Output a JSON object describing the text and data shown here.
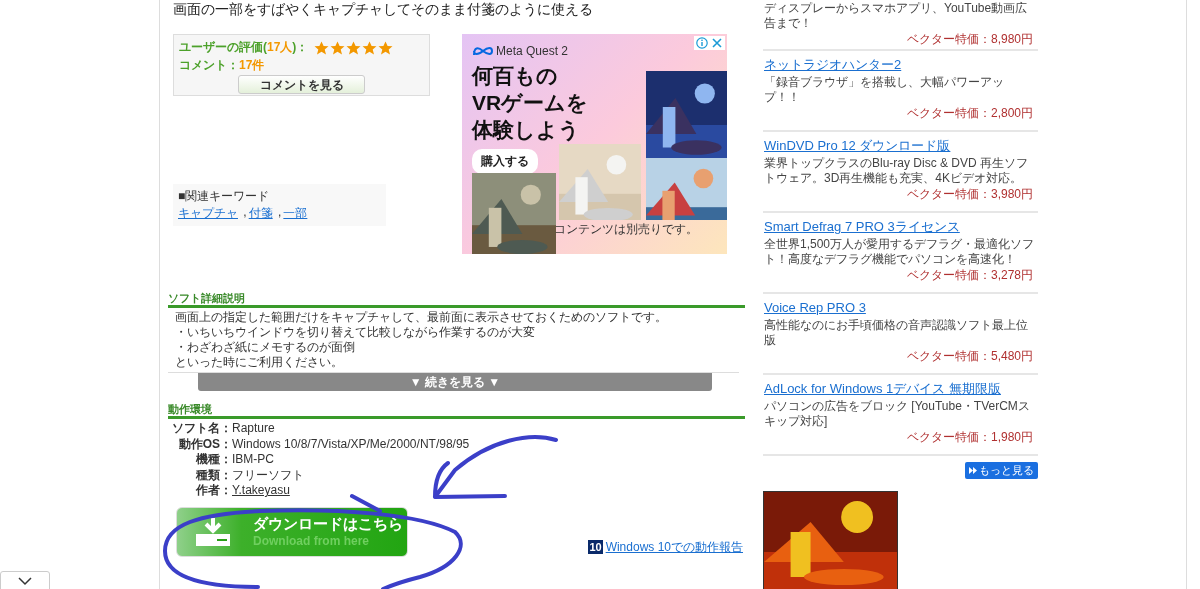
{
  "page_heading": "画面の一部をすばやくキャプチャしてそのまま付箋のように使える",
  "rating": {
    "prefix": "ユーザーの評価(",
    "count": "17人",
    "suffix": ")：",
    "stars": 5,
    "comment_label": "コメント：",
    "comment_count": "17件",
    "button": "コメントを見る"
  },
  "keywords": {
    "title": "■関連キーワード",
    "separator": " ,",
    "links": [
      "キャプチャ",
      "付箋",
      "一部"
    ]
  },
  "ad": {
    "brand": "Meta Quest 2",
    "headline": [
      "何百もの",
      "VRゲームを",
      "体験しよう"
    ],
    "cta": "購入する",
    "note": "コンテンツは別売りです。"
  },
  "description": {
    "title": "ソフト詳細説明",
    "lines": [
      "画面上の指定した範囲だけをキャプチャして、最前面に表示させておくためのソフトです。",
      "・いちいちウインドウを切り替えて比較しながら作業するのが大変",
      "・わざわざ紙にメモするのが面倒",
      "といった時にご利用ください。"
    ],
    "more_button": "▼ 続きを見る ▼"
  },
  "environment": {
    "title": "動作環境",
    "rows": [
      {
        "label": "ソフト名：",
        "value": "Rapture",
        "kind": "text"
      },
      {
        "label": "動作OS：",
        "value": "Windows 10/8/7/Vista/XP/Me/2000/NT/98/95",
        "kind": "text"
      },
      {
        "label": "機種：",
        "value": "IBM-PC",
        "kind": "text"
      },
      {
        "label": "種類：",
        "value": "フリーソフト",
        "kind": "text"
      },
      {
        "label": "作者：",
        "value": "Y.takeyasu",
        "kind": "link"
      }
    ],
    "download_button": {
      "title": "ダウンロードはこちら",
      "subtitle": "Download from here"
    },
    "report_link": {
      "badge": "10",
      "text": "Windows 10での動作報告"
    }
  },
  "sidebar": {
    "products": [
      {
        "description": "ディスプレーからスマホアプリ、YouTube動画広告まで！",
        "price": "ベクター特価：8,980円"
      },
      {
        "title": "ネットラジオハンター2",
        "description": "「録音ブラウザ」を搭載し、大幅パワーアップ！！",
        "price": "ベクター特価：2,800円"
      },
      {
        "title": "WinDVD Pro 12 ダウンロード版",
        "description": "業界トップクラスのBlu-ray Disc & DVD 再生ソフトウェア。3D再生機能も充実、4Kビデオ対応。",
        "price": "ベクター特価：3,980円"
      },
      {
        "title": "Smart Defrag 7 PRO 3ライセンス",
        "description": "全世界1,500万人が愛用するデフラグ・最適化ソフト！高度なデフラグ機能でパソコンを高速化！",
        "price": "ベクター特価：3,278円"
      },
      {
        "title": "Voice Rep PRO 3",
        "description": "高性能なのにお手頃価格の音声認識ソフト最上位版",
        "price": "ベクター特価：5,480円"
      },
      {
        "title": "AdLock for Windows 1デバイス 無期限版",
        "description": "パソコンの広告をブロック [YouTube・TVerCMスキップ対応]",
        "price": "ベクター特価：1,980円"
      }
    ],
    "more_button": "もっと見る"
  }
}
